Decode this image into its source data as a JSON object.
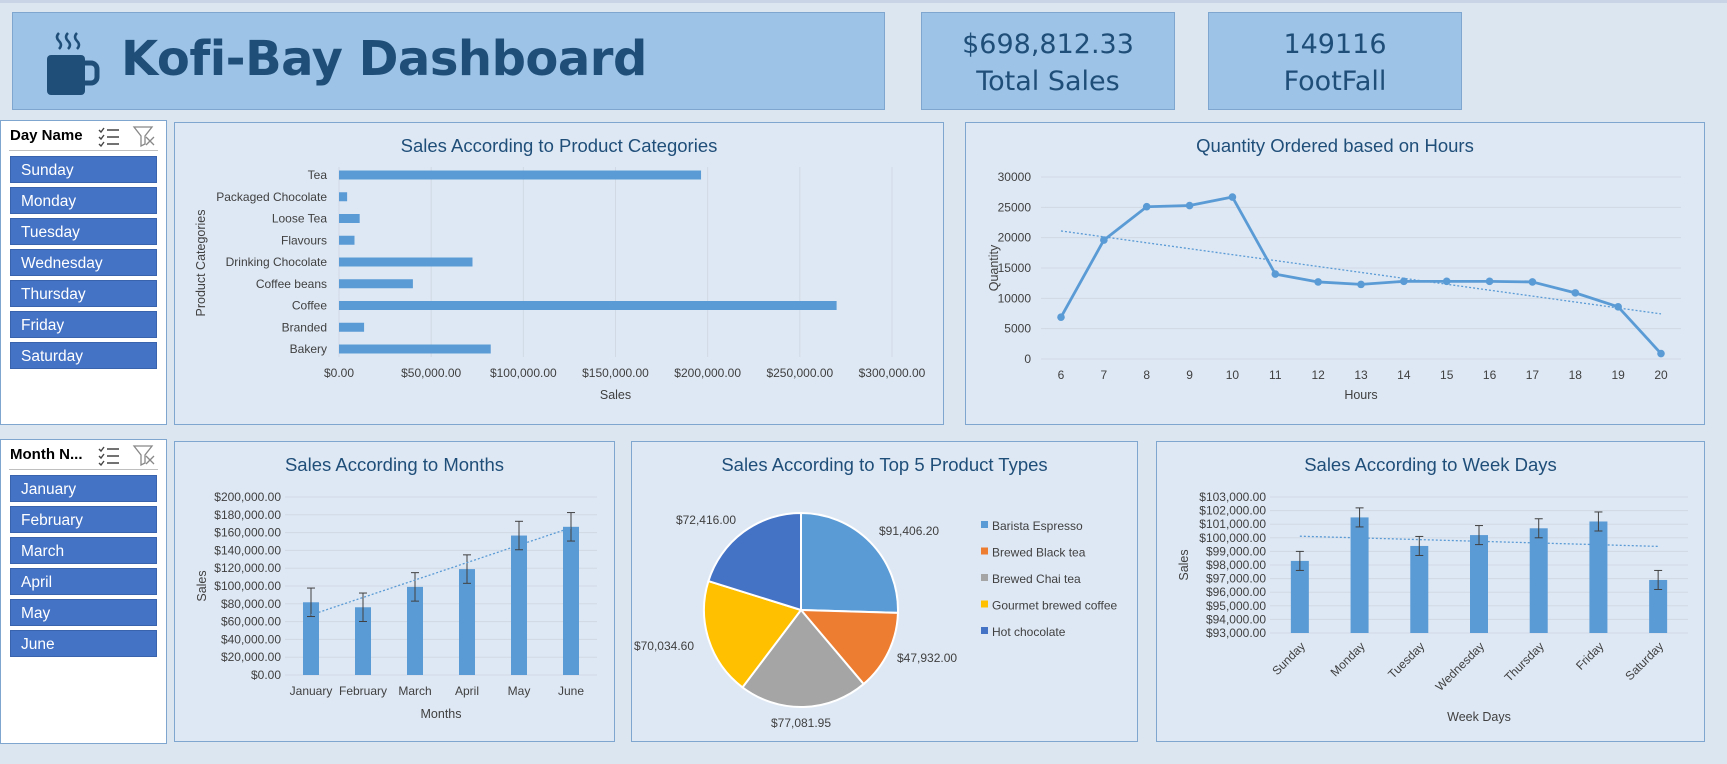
{
  "header": {
    "title": "Kofi-Bay Dashboard",
    "icon": "coffee-mug-icon"
  },
  "kpis": [
    {
      "value": "$698,812.33",
      "label": "Total Sales"
    },
    {
      "value": "149116",
      "label": "FootFall"
    }
  ],
  "slicers": {
    "day": {
      "title": "Day Name",
      "items": [
        "Sunday",
        "Monday",
        "Tuesday",
        "Wednesday",
        "Thursday",
        "Friday",
        "Saturday"
      ]
    },
    "month": {
      "title": "Month N...",
      "items": [
        "January",
        "February",
        "March",
        "April",
        "May",
        "June"
      ]
    }
  },
  "colors": {
    "accent": "#5b9bd5",
    "slicer_item": "#4472c4",
    "title": "#1f4e79",
    "header_bg": "#9dc3e6",
    "panel_bg": "#dee8f4"
  },
  "chart_data": [
    {
      "type": "bar",
      "orientation": "horizontal",
      "title": "Sales According to Product Categories",
      "xlabel": "Sales",
      "ylabel": "Product Categories",
      "categories": [
        "Tea",
        "Packaged Chocolate",
        "Loose Tea",
        "Flavours",
        "Drinking Chocolate",
        "Coffee beans",
        "Coffee",
        "Branded",
        "Bakery"
      ],
      "values": [
        196406,
        4408,
        11214,
        8409,
        72416,
        40086,
        269952,
        13607,
        82316
      ],
      "xlim": [
        0,
        300000
      ],
      "xticks": [
        "$0.00",
        "$50,000.00",
        "$100,000.00",
        "$150,000.00",
        "$200,000.00",
        "$250,000.00",
        "$300,000.00"
      ],
      "grid": true
    },
    {
      "type": "line",
      "title": "Quantity Ordered based on Hours",
      "xlabel": "Hours",
      "ylabel": "Quantity",
      "x": [
        6,
        7,
        8,
        9,
        10,
        11,
        12,
        13,
        14,
        15,
        16,
        17,
        18,
        19,
        20
      ],
      "values": [
        6900,
        19600,
        25100,
        25300,
        26700,
        14000,
        12700,
        12300,
        12800,
        12800,
        12800,
        12700,
        10900,
        8600,
        900
      ],
      "ylim": [
        0,
        30000
      ],
      "yticks": [
        "0",
        "5000",
        "10000",
        "15000",
        "20000",
        "25000",
        "30000"
      ],
      "trendline": "linear",
      "grid": true
    },
    {
      "type": "bar",
      "title": "Sales According to Months",
      "xlabel": "Months",
      "ylabel": "Sales",
      "categories": [
        "January",
        "February",
        "March",
        "April",
        "May",
        "June"
      ],
      "values": [
        81700,
        76100,
        99000,
        119000,
        156700,
        166500
      ],
      "error_bars": true,
      "ylim": [
        0,
        200000
      ],
      "yticks": [
        "$0.00",
        "$20,000.00",
        "$40,000.00",
        "$60,000.00",
        "$80,000.00",
        "$100,000.00",
        "$120,000.00",
        "$140,000.00",
        "$160,000.00",
        "$180,000.00",
        "$200,000.00"
      ],
      "trendline": "linear",
      "grid": true
    },
    {
      "type": "pie",
      "title": "Sales According to Top 5 Product Types",
      "categories": [
        "Barista Espresso",
        "Brewed Black tea",
        "Brewed Chai tea",
        "Gourmet brewed coffee",
        "Hot chocolate"
      ],
      "values": [
        91406.2,
        47932.0,
        77081.95,
        70034.6,
        72416.0
      ],
      "labels": [
        "$91,406.20",
        "$47,932.00",
        "$77,081.95",
        "$70,034.60",
        "$72,416.00"
      ],
      "colors": [
        "#5b9bd5",
        "#ed7d31",
        "#a5a5a5",
        "#ffc000",
        "#4472c4"
      ],
      "legend": "right"
    },
    {
      "type": "bar",
      "title": "Sales According to Week Days",
      "xlabel": "Week Days",
      "ylabel": "Sales",
      "categories": [
        "Sunday",
        "Monday",
        "Tuesday",
        "Wednesday",
        "Thursday",
        "Friday",
        "Saturday"
      ],
      "values": [
        98300,
        101500,
        99400,
        100200,
        100700,
        101200,
        96900
      ],
      "error_bars": true,
      "ylim": [
        93000,
        103000
      ],
      "yticks": [
        "$93,000.00",
        "$94,000.00",
        "$95,000.00",
        "$96,000.00",
        "$97,000.00",
        "$98,000.00",
        "$99,000.00",
        "$100,000.00",
        "$101,000.00",
        "$102,000.00",
        "$103,000.00"
      ],
      "trendline": "linear",
      "grid": true
    }
  ]
}
